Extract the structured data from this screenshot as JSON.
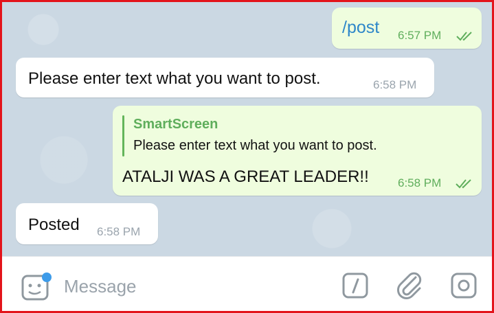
{
  "messages": {
    "m1": {
      "text": "/post",
      "time": "6:57 PM"
    },
    "m2": {
      "text": "Please enter text what you want to post.",
      "time": "6:58 PM"
    },
    "m3": {
      "reply_name": "SmartScreen",
      "reply_text": "Please enter text what you want to post.",
      "text": "ATALJI WAS A GREAT LEADER!!",
      "time": "6:58 PM"
    },
    "m4": {
      "text": "Posted",
      "time": "6:58 PM"
    }
  },
  "input": {
    "placeholder": "Message"
  },
  "icons": {
    "sticker": "sticker-icon",
    "command": "slash-command-icon",
    "attach": "paperclip-icon",
    "camera": "camera-icon"
  },
  "colors": {
    "outgoing_bubble": "#effdde",
    "incoming_bubble": "#ffffff",
    "accent_green": "#5fae5c",
    "command_blue": "#2e87c9",
    "frame_red": "#e3141b",
    "badge_blue": "#3d9be9"
  }
}
